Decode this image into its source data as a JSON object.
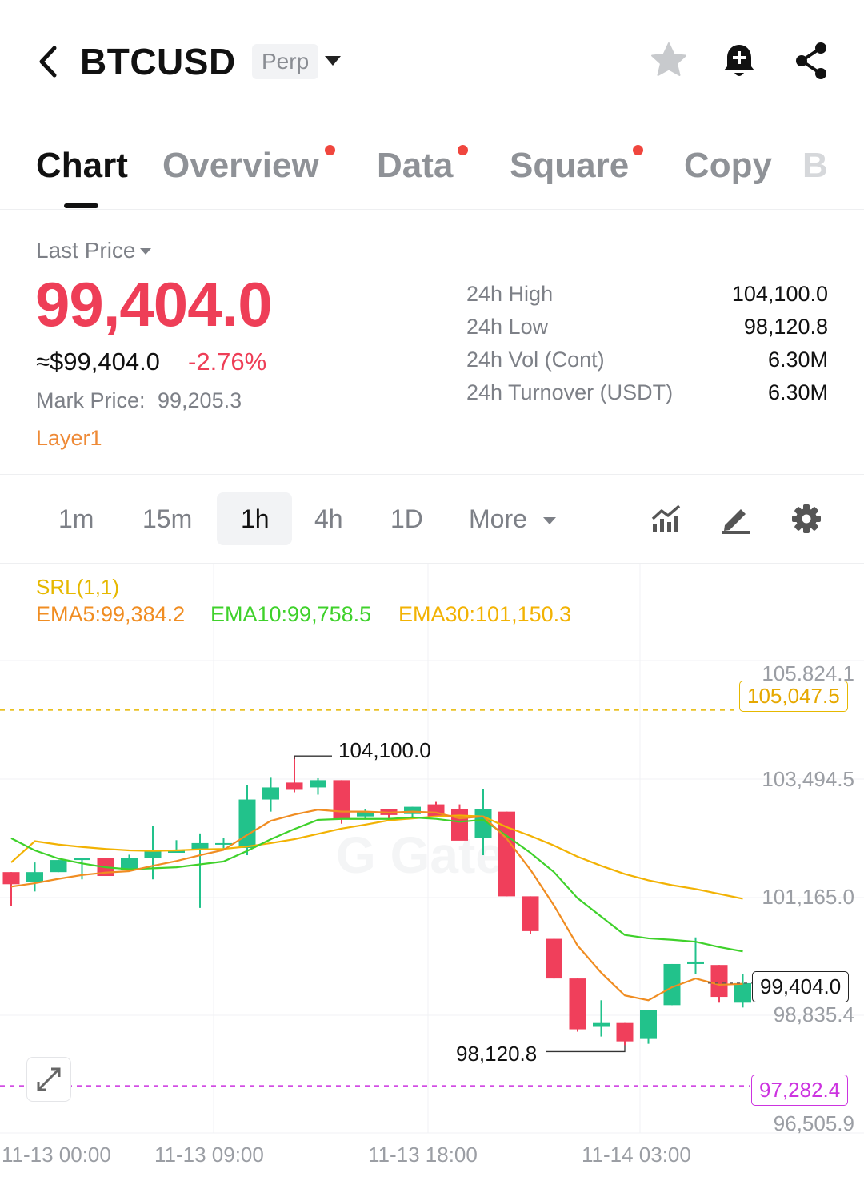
{
  "header": {
    "symbol": "BTCUSD",
    "badge": "Perp",
    "icons": [
      "back-icon",
      "star-icon",
      "bell-plus-icon",
      "share-icon"
    ]
  },
  "tabs": [
    {
      "label": "Chart",
      "active": true,
      "dot": false
    },
    {
      "label": "Overview",
      "active": false,
      "dot": true
    },
    {
      "label": "Data",
      "active": false,
      "dot": true
    },
    {
      "label": "Square",
      "active": false,
      "dot": true
    },
    {
      "label": "Copy",
      "active": false,
      "dot": false
    },
    {
      "label": "B",
      "active": false,
      "dot": false
    }
  ],
  "price": {
    "last_label": "Last Price",
    "last": "99,404.0",
    "usd": "≈$99,404.0",
    "change": "-2.76%",
    "mark_label": "Mark Price:",
    "mark": "99,205.3",
    "category": "Layer1"
  },
  "stats": [
    {
      "label": "24h High",
      "value": "104,100.0"
    },
    {
      "label": "24h Low",
      "value": "98,120.8"
    },
    {
      "label": "24h Vol (Cont)",
      "value": "6.30M"
    },
    {
      "label": "24h Turnover (USDT)",
      "value": "6.30M"
    }
  ],
  "intervals": {
    "items": [
      "1m",
      "15m",
      "1h",
      "4h",
      "1D"
    ],
    "active": "1h",
    "more": "More"
  },
  "indicators": {
    "srl": "SRL(1,1)",
    "ema5": "EMA5:99,384.2",
    "ema10": "EMA10:99,758.5",
    "ema30": "EMA30:101,150.3"
  },
  "colors": {
    "up": "#22c28b",
    "down": "#f03f5b",
    "ema5": "#f08d22",
    "ema10": "#3fd12b",
    "ema30": "#f2b203",
    "srl": "#e6b800",
    "support": "#cc33e0",
    "accent_price": "#ee3e57"
  },
  "chart": {
    "y_axis_labels": [
      "105,824.1",
      "103,494.5",
      "101,165.0",
      "98,835.4",
      "96,505.9"
    ],
    "x_axis_labels": [
      "11-13 00:00",
      "11-13 09:00",
      "11-13 18:00",
      "11-14 03:00"
    ],
    "resistance_label": "105,047.5",
    "support_label": "97,282.4",
    "last_price_label": "99,404.0",
    "high_marker": "104,100.0",
    "low_marker": "98,120.8"
  },
  "chart_data": {
    "type": "candlestick",
    "interval": "1h",
    "ylim": [
      96505.9,
      105824.1
    ],
    "resistance": 105047.5,
    "support": 97282.4,
    "candles": [
      {
        "o": 101700,
        "h": 101700,
        "l": 101000,
        "c": 101450
      },
      {
        "o": 101500,
        "h": 101900,
        "l": 101300,
        "c": 101700
      },
      {
        "o": 101700,
        "h": 101950,
        "l": 101700,
        "c": 101950
      },
      {
        "o": 101950,
        "h": 102000,
        "l": 101550,
        "c": 102000
      },
      {
        "o": 102000,
        "h": 102000,
        "l": 101620,
        "c": 101620
      },
      {
        "o": 101740,
        "h": 102060,
        "l": 101740,
        "c": 102000
      },
      {
        "o": 102000,
        "h": 102650,
        "l": 101550,
        "c": 102150
      },
      {
        "o": 102100,
        "h": 102360,
        "l": 102100,
        "c": 102150
      },
      {
        "o": 102150,
        "h": 102500,
        "l": 100960,
        "c": 102300
      },
      {
        "o": 102300,
        "h": 102400,
        "l": 102150,
        "c": 102300
      },
      {
        "o": 102200,
        "h": 103500,
        "l": 102050,
        "c": 103200
      },
      {
        "o": 103200,
        "h": 103650,
        "l": 102950,
        "c": 103450
      },
      {
        "o": 103550,
        "h": 104100,
        "l": 103350,
        "c": 103400
      },
      {
        "o": 103450,
        "h": 103640,
        "l": 103300,
        "c": 103600
      },
      {
        "o": 103600,
        "h": 103600,
        "l": 102700,
        "c": 102800
      },
      {
        "o": 102850,
        "h": 103000,
        "l": 102800,
        "c": 102950
      },
      {
        "o": 103000,
        "h": 103000,
        "l": 102800,
        "c": 102880
      },
      {
        "o": 102900,
        "h": 103050,
        "l": 102800,
        "c": 103050
      },
      {
        "o": 103100,
        "h": 103150,
        "l": 102900,
        "c": 102850
      },
      {
        "o": 103000,
        "h": 103100,
        "l": 102500,
        "c": 102350
      },
      {
        "o": 102400,
        "h": 103410,
        "l": 102050,
        "c": 103000
      },
      {
        "o": 102950,
        "h": 102950,
        "l": 101200,
        "c": 101200
      },
      {
        "o": 101200,
        "h": 101200,
        "l": 100420,
        "c": 100480
      },
      {
        "o": 100320,
        "h": 100320,
        "l": 99500,
        "c": 99500
      },
      {
        "o": 99500,
        "h": 99500,
        "l": 98400,
        "c": 98450
      },
      {
        "o": 98500,
        "h": 99050,
        "l": 98300,
        "c": 98580
      },
      {
        "o": 98580,
        "h": 98580,
        "l": 98120.8,
        "c": 98200
      },
      {
        "o": 98250,
        "h": 98850,
        "l": 98150,
        "c": 98850
      },
      {
        "o": 98950,
        "h": 99800,
        "l": 98950,
        "c": 99800
      },
      {
        "o": 99800,
        "h": 100350,
        "l": 99600,
        "c": 99850
      },
      {
        "o": 99780,
        "h": 99780,
        "l": 99000,
        "c": 99120
      },
      {
        "o": 99000,
        "h": 99600,
        "l": 98900,
        "c": 99404
      }
    ],
    "ema5": [
      101400,
      101470,
      101560,
      101640,
      101690,
      101720,
      101830,
      101930,
      102050,
      102160,
      102470,
      102760,
      102890,
      102990,
      102950,
      102950,
      102930,
      102950,
      102930,
      102810,
      102850,
      102390,
      101750,
      101010,
      100180,
      99620,
      99150,
      99050,
      99320,
      99500,
      99370,
      99390
    ],
    "ema10": [
      102400,
      102150,
      101980,
      101880,
      101800,
      101760,
      101780,
      101800,
      101860,
      101920,
      102140,
      102380,
      102590,
      102780,
      102800,
      102800,
      102800,
      102830,
      102800,
      102740,
      102780,
      102450,
      102100,
      101700,
      101160,
      100780,
      100400,
      100330,
      100300,
      100260,
      100150,
      100060
    ],
    "ema30": [
      101900,
      102340,
      102270,
      102220,
      102180,
      102150,
      102140,
      102150,
      102170,
      102180,
      102230,
      102300,
      102380,
      102490,
      102600,
      102680,
      102770,
      102810,
      102850,
      102870,
      102850,
      102630,
      102450,
      102250,
      102020,
      101830,
      101660,
      101530,
      101430,
      101350,
      101250,
      101150
    ]
  }
}
